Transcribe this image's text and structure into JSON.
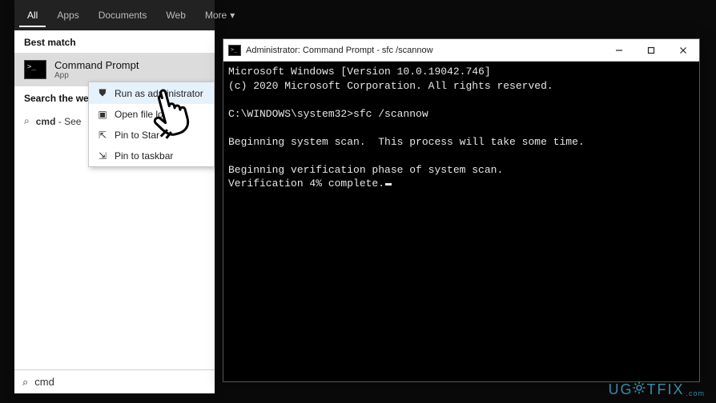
{
  "tabs": {
    "all": "All",
    "apps": "Apps",
    "documents": "Documents",
    "web": "Web",
    "more": "More"
  },
  "best_match_heading": "Best match",
  "best_match": {
    "title": "Command Prompt",
    "subtitle": "App"
  },
  "search_web_heading": "Search the web",
  "web_item": {
    "query": "cmd",
    "suffix": " - See"
  },
  "ctx": {
    "run_admin": "Run as administrator",
    "open_loc": "Open file lo",
    "pin_start": "Pin to Star",
    "pin_taskbar": "Pin to taskbar"
  },
  "search_input": "cmd",
  "cmd_window": {
    "title": "Administrator: Command Prompt - sfc  /scannow",
    "lines": {
      "l1": "Microsoft Windows [Version 10.0.19042.746]",
      "l2": "(c) 2020 Microsoft Corporation. All rights reserved.",
      "l3": "",
      "l4": "C:\\WINDOWS\\system32>sfc /scannow",
      "l5": "",
      "l6": "Beginning system scan.  This process will take some time.",
      "l7": "",
      "l8": "Beginning verification phase of system scan.",
      "l9": "Verification 4% complete."
    }
  },
  "watermark": {
    "pre": "UG",
    "post": "TFIX",
    "sub": ".com"
  }
}
